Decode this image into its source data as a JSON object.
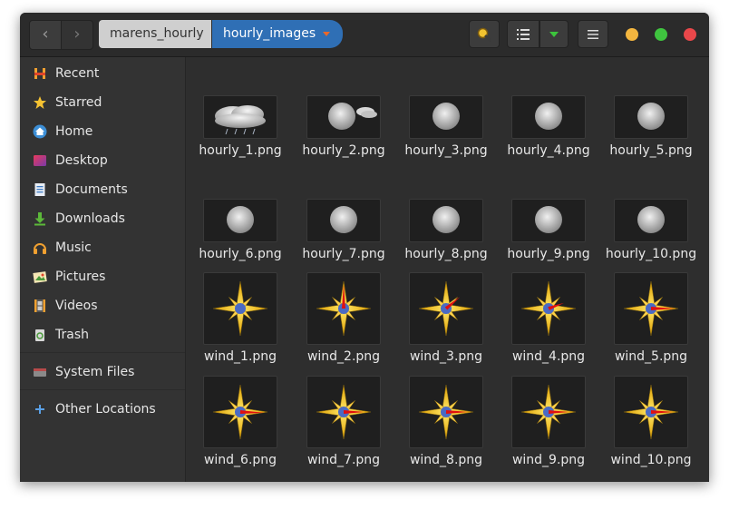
{
  "headerbar": {
    "back_icon": "chevron-left-icon",
    "forward_icon": "chevron-right-icon",
    "breadcrumbs": [
      "marens_hourly",
      "hourly_images"
    ],
    "search_icon": "search-icon",
    "view_icon": "list-view-icon",
    "view_dropdown_icon": "dropdown-arrow-icon",
    "menu_icon": "hamburger-menu-icon",
    "window_controls": {
      "minimize_color": "#f4b63f",
      "maximize_color": "#3fc43f",
      "close_color": "#e9474a"
    }
  },
  "sidebar": {
    "items": [
      {
        "label": "Recent",
        "icon": "recent-icon"
      },
      {
        "label": "Starred",
        "icon": "star-icon"
      },
      {
        "label": "Home",
        "icon": "home-icon"
      },
      {
        "label": "Desktop",
        "icon": "desktop-icon"
      },
      {
        "label": "Documents",
        "icon": "documents-icon"
      },
      {
        "label": "Downloads",
        "icon": "downloads-icon"
      },
      {
        "label": "Music",
        "icon": "music-icon"
      },
      {
        "label": "Pictures",
        "icon": "pictures-icon"
      },
      {
        "label": "Videos",
        "icon": "videos-icon"
      },
      {
        "label": "Trash",
        "icon": "trash-icon"
      },
      {
        "label": "System Files",
        "icon": "drive-icon"
      },
      {
        "label": "Other Locations",
        "icon": "plus-icon"
      }
    ]
  },
  "files": [
    {
      "name": "hourly_1.png",
      "thumb": "cloud-rain-icon"
    },
    {
      "name": "hourly_2.png",
      "thumb": "moon-cloud-icon"
    },
    {
      "name": "hourly_3.png",
      "thumb": "moon-icon"
    },
    {
      "name": "hourly_4.png",
      "thumb": "moon-icon"
    },
    {
      "name": "hourly_5.png",
      "thumb": "moon-icon"
    },
    {
      "name": "hourly_6.png",
      "thumb": "moon-icon"
    },
    {
      "name": "hourly_7.png",
      "thumb": "moon-icon"
    },
    {
      "name": "hourly_8.png",
      "thumb": "moon-icon"
    },
    {
      "name": "hourly_9.png",
      "thumb": "moon-icon"
    },
    {
      "name": "hourly_10.png",
      "thumb": "moon-icon"
    },
    {
      "name": "wind_1.png",
      "thumb": "compass-icon"
    },
    {
      "name": "wind_2.png",
      "thumb": "compass-icon"
    },
    {
      "name": "wind_3.png",
      "thumb": "compass-icon"
    },
    {
      "name": "wind_4.png",
      "thumb": "compass-icon"
    },
    {
      "name": "wind_5.png",
      "thumb": "compass-icon"
    },
    {
      "name": "wind_6.png",
      "thumb": "compass-icon"
    },
    {
      "name": "wind_7.png",
      "thumb": "compass-icon"
    },
    {
      "name": "wind_8.png",
      "thumb": "compass-icon"
    },
    {
      "name": "wind_9.png",
      "thumb": "compass-icon"
    },
    {
      "name": "wind_10.png",
      "thumb": "compass-icon"
    }
  ]
}
